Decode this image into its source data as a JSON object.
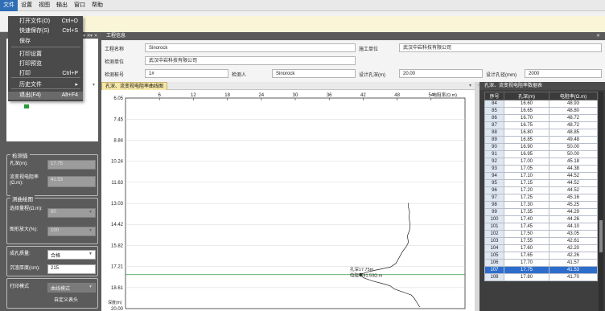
{
  "menubar": [
    "文件",
    "设置",
    "视图",
    "输出",
    "窗口",
    "帮助"
  ],
  "file_menu": {
    "items": [
      {
        "label": "打开文件(O)",
        "shortcut": "Ctrl+O"
      },
      {
        "label": "快速保存(S)",
        "shortcut": "Ctrl+S"
      },
      {
        "label": "保存",
        "shortcut": ""
      },
      {
        "label": "打印设置",
        "shortcut": ""
      },
      {
        "label": "打印预览",
        "shortcut": ""
      },
      {
        "label": "打印",
        "shortcut": "Ctrl+P"
      },
      {
        "label": "历史文件",
        "shortcut": "▸"
      },
      {
        "label": "退出(F4)",
        "shortcut": "Alt+F4"
      }
    ]
  },
  "info_panel": {
    "title": "工程信息",
    "project_name_label": "工程名称",
    "project_name": "Sinorock",
    "build_unit_label": "施工单位",
    "build_unit": "武汉中岩科技有限公司",
    "test_unit_label": "检测单位",
    "test_unit": "武汉中岩科技有限公司",
    "hole_no_label": "检测桩号",
    "hole_no": "1#",
    "tester_label": "检测人",
    "tester": "Sinorock",
    "design_depth_label": "设计孔深(m)",
    "design_depth": "20.00",
    "design_dia_label": "设计孔径(mm)",
    "design_dia": "2000"
  },
  "left": {
    "group_measure": "检测值",
    "depth_label": "孔深(m):",
    "depth_value": "17.75",
    "resistivity_label": "流变视电阻率(Ω.m):",
    "resistivity_value": "41.53",
    "group_plot": "测曲绘图",
    "scale_label": "选择量程(Ω.m):",
    "scale_value": "60",
    "zoom_label": "图形放大(%):",
    "zoom_value": "100",
    "quality_label": "成孔质量:",
    "quality_value": "合格",
    "sediment_label": "沉渣厚度(cm):",
    "sediment_value": "215",
    "print_mode_label": "打印模式",
    "print_mode_value": "曲线模式",
    "custom_header": "自定义表头"
  },
  "chart_panel": {
    "title": "孔深、流变视电阻率曲线图"
  },
  "chart_data": {
    "type": "line",
    "title": "",
    "xlabel": "电阻率(Ω.m)",
    "ylabel": "深度(m)",
    "x_ticks": [
      "6",
      "12",
      "18",
      "24",
      "30",
      "36",
      "42",
      "48",
      "54"
    ],
    "y_ticks": [
      "6.05",
      "7.45",
      "8.84",
      "10.24",
      "11.63",
      "13.03",
      "14.42",
      "15.82",
      "17.21",
      "18.61",
      "20.00"
    ],
    "xlim": [
      0,
      60
    ],
    "ylim": [
      6.05,
      20.0
    ],
    "grid": true,
    "series": [
      {
        "name": "",
        "points": [
          [
            50.0,
            13.0
          ],
          [
            50.0,
            13.3
          ],
          [
            50.2,
            13.6
          ],
          [
            50.1,
            14.0
          ],
          [
            50.3,
            14.4
          ],
          [
            50.2,
            14.8
          ],
          [
            49.8,
            15.2
          ],
          [
            50.0,
            15.6
          ],
          [
            49.6,
            15.9
          ],
          [
            49.0,
            16.2
          ],
          [
            48.4,
            16.6
          ],
          [
            47.8,
            17.0
          ],
          [
            46.8,
            17.25
          ],
          [
            44.2,
            17.45
          ],
          [
            42.5,
            17.6
          ],
          [
            41.5,
            17.75
          ],
          [
            42.0,
            17.95
          ],
          [
            43.5,
            18.15
          ],
          [
            45.5,
            18.35
          ],
          [
            46.8,
            18.5
          ],
          [
            47.5,
            18.7
          ],
          [
            49.0,
            18.9
          ],
          [
            50.5,
            19.1
          ],
          [
            51.0,
            19.3
          ],
          [
            51.5,
            19.6
          ],
          [
            52.0,
            19.9
          ]
        ]
      }
    ],
    "annotations": [
      {
        "text": "孔深17.75m",
        "x": 42.5,
        "y": 17.4
      },
      {
        "text": "电阻率41.53Ω.m",
        "x": 42.5,
        "y": 17.8
      }
    ]
  },
  "table_panel": {
    "title": "孔深、流变视电阻率数据表",
    "headers": [
      "序号",
      "孔深(m)",
      "电阻率(Ω.m)"
    ],
    "selected_row": 107,
    "rows": [
      [
        "84",
        "16.60",
        "48.93"
      ],
      [
        "85",
        "16.65",
        "48.80"
      ],
      [
        "86",
        "16.70",
        "48.72"
      ],
      [
        "87",
        "16.75",
        "48.72"
      ],
      [
        "88",
        "16.80",
        "48.85"
      ],
      [
        "89",
        "16.85",
        "49.48"
      ],
      [
        "90",
        "16.90",
        "50.00"
      ],
      [
        "91",
        "16.95",
        "50.00"
      ],
      [
        "92",
        "17.00",
        "45.18"
      ],
      [
        "93",
        "17.05",
        "44.38"
      ],
      [
        "94",
        "17.10",
        "44.52"
      ],
      [
        "95",
        "17.15",
        "44.52"
      ],
      [
        "96",
        "17.20",
        "44.52"
      ],
      [
        "97",
        "17.25",
        "45.16"
      ],
      [
        "98",
        "17.30",
        "45.25"
      ],
      [
        "99",
        "17.35",
        "44.29"
      ],
      [
        "100",
        "17.40",
        "44.26"
      ],
      [
        "101",
        "17.45",
        "44.10"
      ],
      [
        "102",
        "17.50",
        "43.05"
      ],
      [
        "103",
        "17.55",
        "42.61"
      ],
      [
        "104",
        "17.60",
        "42.20"
      ],
      [
        "105",
        "17.65",
        "42.26"
      ],
      [
        "106",
        "17.70",
        "41.57"
      ],
      [
        "107",
        "17.75",
        "41.53"
      ],
      [
        "108",
        "17.80",
        "41.70"
      ]
    ]
  }
}
